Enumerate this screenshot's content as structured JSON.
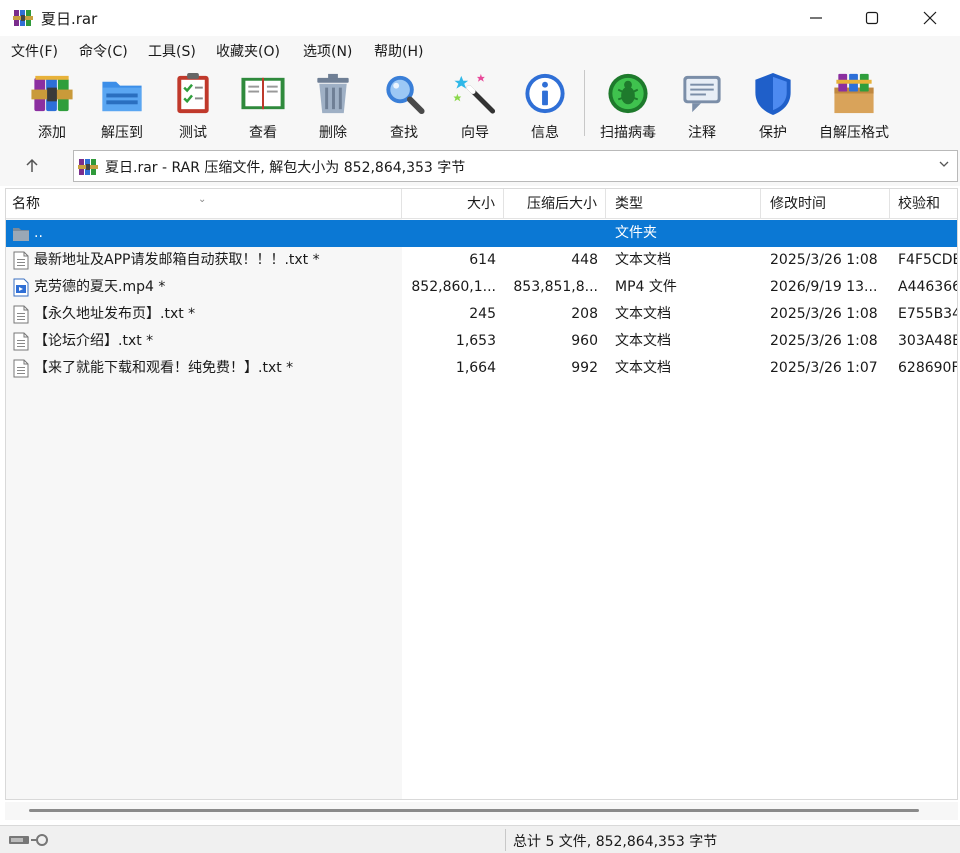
{
  "window": {
    "title": "夏日.rar",
    "minimize_icon": "minimize-icon",
    "maximize_icon": "maximize-icon",
    "close_icon": "close-icon"
  },
  "menu": [
    "文件(F)",
    "命令(C)",
    "工具(S)",
    "收藏夹(O)",
    "选项(N)",
    "帮助(H)"
  ],
  "toolbar": [
    {
      "label": "添加",
      "icon": "add-archive-icon"
    },
    {
      "label": "解压到",
      "icon": "extract-folder-icon"
    },
    {
      "label": "测试",
      "icon": "test-clipboard-icon"
    },
    {
      "label": "查看",
      "icon": "view-book-icon"
    },
    {
      "label": "删除",
      "icon": "trash-icon"
    },
    {
      "label": "查找",
      "icon": "magnifier-icon"
    },
    {
      "label": "向导",
      "icon": "wizard-wand-icon"
    },
    {
      "label": "信息",
      "icon": "info-icon"
    },
    {
      "label": "扫描病毒",
      "icon": "virus-scan-icon"
    },
    {
      "label": "注释",
      "icon": "comment-icon"
    },
    {
      "label": "保护",
      "icon": "shield-icon"
    },
    {
      "label": "自解压格式",
      "icon": "sfx-box-icon"
    }
  ],
  "address": {
    "text": "夏日.rar - RAR 压缩文件, 解包大小为 852,864,353 字节"
  },
  "columns": [
    "名称",
    "大小",
    "压缩后大小",
    "类型",
    "修改时间",
    "校验和"
  ],
  "files": [
    {
      "name": "..",
      "size": "",
      "packed": "",
      "type": "文件夹",
      "modified": "",
      "crc": "",
      "icon": "folder-icon",
      "selected": true
    },
    {
      "name": "最新地址及APP请发邮箱自动获取！！！.txt *",
      "size": "614",
      "packed": "448",
      "type": "文本文档",
      "modified": "2025/3/26 1:08",
      "crc": "F4F5CDE",
      "icon": "text-file-icon",
      "selected": false
    },
    {
      "name": "克劳德的夏天.mp4 *",
      "size": "852,860,1...",
      "packed": "853,851,8...",
      "type": "MP4 文件",
      "modified": "2026/9/19 13...",
      "crc": "A446366",
      "icon": "video-file-icon",
      "selected": false
    },
    {
      "name": "【永久地址发布页】.txt *",
      "size": "245",
      "packed": "208",
      "type": "文本文档",
      "modified": "2025/3/26 1:08",
      "crc": "E755B34",
      "icon": "text-file-icon",
      "selected": false
    },
    {
      "name": "【论坛介绍】.txt *",
      "size": "1,653",
      "packed": "960",
      "type": "文本文档",
      "modified": "2025/3/26 1:08",
      "crc": "303A48E",
      "icon": "text-file-icon",
      "selected": false
    },
    {
      "name": "【来了就能下载和观看！纯免费！】.txt *",
      "size": "1,664",
      "packed": "992",
      "type": "文本文档",
      "modified": "2025/3/26 1:07",
      "crc": "628690F",
      "icon": "text-file-icon",
      "selected": false
    }
  ],
  "status": {
    "text": "总计 5 文件, 852,864,353 字节",
    "icon": "drive-key-icon"
  },
  "colors": {
    "selection": "#0b78d4",
    "panel": "#f7f7f7"
  }
}
